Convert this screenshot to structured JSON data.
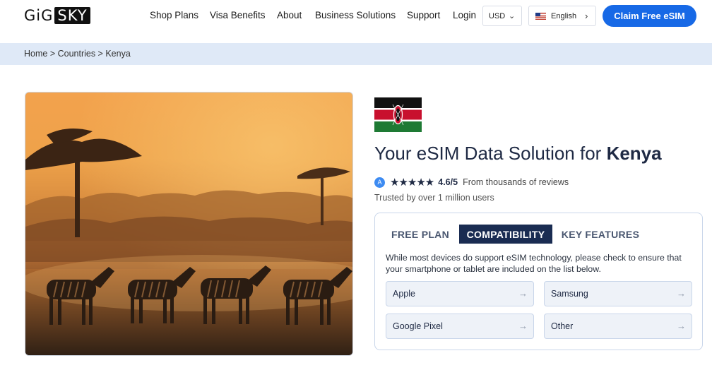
{
  "header": {
    "logo_left": "GiG",
    "logo_right": "SKY",
    "nav": [
      "Shop Plans",
      "Visa Benefits",
      "About",
      "Business Solutions",
      "Support",
      "Login"
    ],
    "currency": "USD",
    "language": "English",
    "cta": "Claim Free eSIM"
  },
  "breadcrumb": "Home > Countries > Kenya",
  "hero": {
    "title_prefix": "Your eSIM Data Solution for ",
    "title_country": "Kenya",
    "stars": "★★★★★",
    "score": "4.6/5",
    "reviews": "From thousands of reviews",
    "trusted": "Trusted by over 1 million users"
  },
  "tabs": {
    "free_plan": "FREE PLAN",
    "compatibility": "COMPATIBILITY",
    "key_features": "KEY FEATURES"
  },
  "compat": {
    "description": "While most devices do support eSIM technology, please check to ensure that your smartphone or tablet are included on the list below.",
    "devices": [
      "Apple",
      "Samsung",
      "Google Pixel",
      "Other"
    ],
    "arrow": "→"
  },
  "colors": {
    "brand_blue": "#1769e6",
    "navy": "#1a2c52",
    "breadcrumb_bg": "#dfe9f7"
  }
}
